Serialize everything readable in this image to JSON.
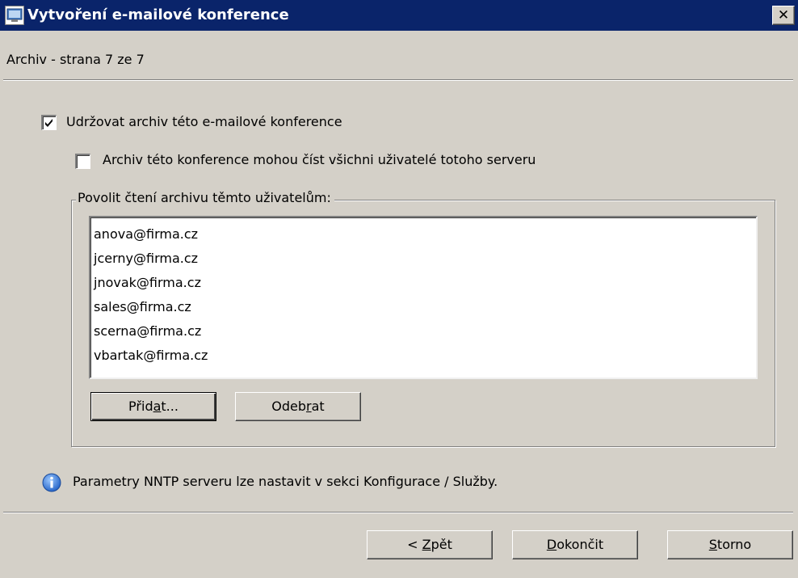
{
  "window": {
    "title": "Vytvoření e-mailové konference",
    "close_label": "✕"
  },
  "page": {
    "header": "Archiv - strana 7 ze 7"
  },
  "options": {
    "keep_archive": {
      "label": "Udržovat archiv této e-mailové konference",
      "checked": true
    },
    "all_users_read": {
      "label": "Archiv této konference mohou číst všichni uživatelé totoho serveru",
      "checked": false
    }
  },
  "group": {
    "legend": "Povolit čtení archivu těmto uživatelům:",
    "users": [
      "anova@firma.cz",
      "jcerny@firma.cz",
      "jnovak@firma.cz",
      "sales@firma.cz",
      "scerna@firma.cz",
      "vbartak@firma.cz"
    ],
    "add_button": {
      "pre": "Přid",
      "accel": "a",
      "post": "t..."
    },
    "remove_button": {
      "pre": "Odeb",
      "accel": "r",
      "post": "at"
    }
  },
  "info": {
    "icon": "info-icon",
    "text": "Parametry NNTP serveru lze nastavit v sekci Konfigurace / Služby."
  },
  "footer": {
    "back_button": {
      "pre": "< ",
      "accel": "Z",
      "post": "pět"
    },
    "finish_button": {
      "pre": "",
      "accel": "D",
      "post": "okončit"
    },
    "cancel_button": {
      "pre": "",
      "accel": "S",
      "post": "torno"
    }
  },
  "colors": {
    "titlebar": "#0a246a",
    "dialog_bg": "#d4d0c8",
    "info_icon": "#2a6fd6"
  }
}
